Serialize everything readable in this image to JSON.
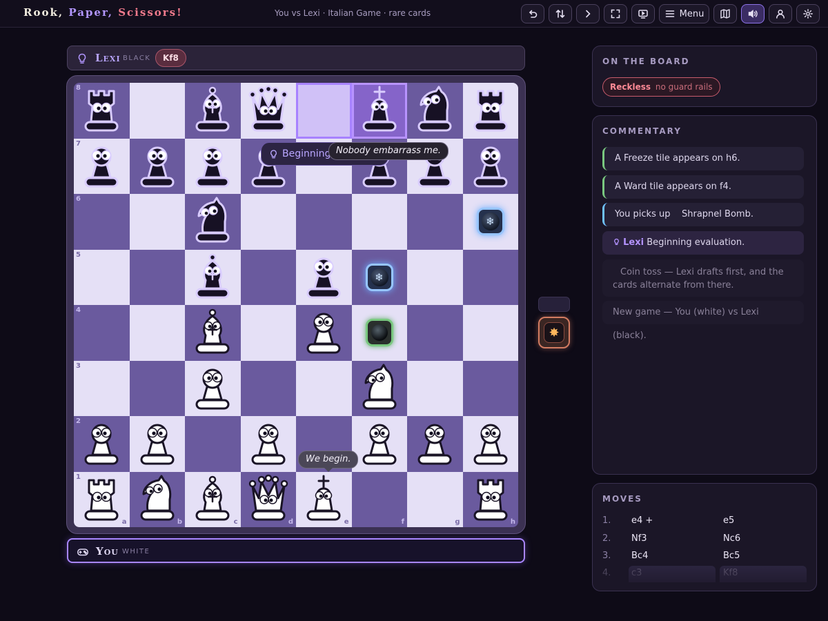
{
  "app": {
    "logo_parts": [
      "Rook, ",
      "Paper, ",
      "Scissors!"
    ],
    "subtitle": "You vs Lexi · Italian Game · rare cards"
  },
  "toolbar": {
    "menu_label": "Menu",
    "buttons": [
      "undo-icon",
      "flip-icon",
      "next-icon",
      "fullscreen-icon",
      "tv-icon",
      "menu-icon",
      "map-icon",
      "sound-icon",
      "user-icon",
      "gear-icon"
    ]
  },
  "opponent": {
    "name": "Lexi",
    "color": "black",
    "last_move": "Kf8"
  },
  "player": {
    "name": "You",
    "color": "white"
  },
  "board": {
    "files": [
      "a",
      "b",
      "c",
      "d",
      "e",
      "f",
      "g",
      "h"
    ],
    "ranks": [
      "1",
      "2",
      "3",
      "4",
      "5",
      "6",
      "7",
      "8"
    ],
    "highlight_from": "e8",
    "highlight_to": "f8",
    "pieces": [
      {
        "sq": "a8",
        "type": "rook",
        "color": "black"
      },
      {
        "sq": "c8",
        "type": "bishop",
        "color": "black"
      },
      {
        "sq": "d8",
        "type": "queen",
        "color": "black"
      },
      {
        "sq": "f8",
        "type": "king",
        "color": "black"
      },
      {
        "sq": "g8",
        "type": "knight",
        "color": "black"
      },
      {
        "sq": "h8",
        "type": "rook",
        "color": "black"
      },
      {
        "sq": "a7",
        "type": "pawn",
        "color": "black"
      },
      {
        "sq": "b7",
        "type": "pawn",
        "color": "black"
      },
      {
        "sq": "c7",
        "type": "pawn",
        "color": "black"
      },
      {
        "sq": "d7",
        "type": "pawn",
        "color": "black"
      },
      {
        "sq": "f7",
        "type": "pawn",
        "color": "black"
      },
      {
        "sq": "g7",
        "type": "pawn",
        "color": "black"
      },
      {
        "sq": "h7",
        "type": "pawn",
        "color": "black"
      },
      {
        "sq": "c6",
        "type": "knight",
        "color": "black"
      },
      {
        "sq": "c5",
        "type": "bishop",
        "color": "black"
      },
      {
        "sq": "e5",
        "type": "pawn",
        "color": "black"
      },
      {
        "sq": "c4",
        "type": "bishop",
        "color": "white"
      },
      {
        "sq": "e4",
        "type": "pawn",
        "color": "white"
      },
      {
        "sq": "c3",
        "type": "pawn",
        "color": "white"
      },
      {
        "sq": "f3",
        "type": "knight",
        "color": "white"
      },
      {
        "sq": "a2",
        "type": "pawn",
        "color": "white"
      },
      {
        "sq": "b2",
        "type": "pawn",
        "color": "white"
      },
      {
        "sq": "d2",
        "type": "pawn",
        "color": "white"
      },
      {
        "sq": "f2",
        "type": "pawn",
        "color": "white"
      },
      {
        "sq": "g2",
        "type": "pawn",
        "color": "white"
      },
      {
        "sq": "h2",
        "type": "pawn",
        "color": "white"
      },
      {
        "sq": "a1",
        "type": "rook",
        "color": "white"
      },
      {
        "sq": "b1",
        "type": "knight",
        "color": "white"
      },
      {
        "sq": "c1",
        "type": "bishop",
        "color": "white"
      },
      {
        "sq": "d1",
        "type": "queen",
        "color": "white"
      },
      {
        "sq": "e1",
        "type": "king",
        "color": "white"
      },
      {
        "sq": "h1",
        "type": "rook",
        "color": "white"
      }
    ],
    "tiles": [
      {
        "sq": "h6",
        "type": "freeze",
        "symbol": "❄"
      },
      {
        "sq": "f5",
        "type": "freeze",
        "symbol": "❄"
      },
      {
        "sq": "f4",
        "type": "ward",
        "symbol": ""
      }
    ],
    "bubbles": {
      "thinking": "Beginning",
      "lexi_quote": "Nobody embarrass me.",
      "you_quote": "We begin."
    }
  },
  "cards": {
    "held_symbol": "✸"
  },
  "on_board": {
    "title": "ON THE BOARD",
    "tag_name": "Reckless",
    "tag_desc": "no guard rails"
  },
  "commentary": {
    "title": "COMMENTARY",
    "items": [
      {
        "text": "A Freeze tile appears on h6."
      },
      {
        "text": "A Ward tile appears on f4."
      },
      {
        "text": "You picks up    Shrapnel Bomb."
      },
      {
        "who": "Lexi",
        "text": "Beginning evaluation."
      },
      {
        "text": "Coin toss — Lexi drafts first, and the cards alternate from there."
      },
      {
        "text": "New game — You (white) vs Lexi (black)."
      }
    ]
  },
  "moves": {
    "title": "MOVES",
    "rows": [
      {
        "no": "1.",
        "white": "e4 +",
        "black": "e5"
      },
      {
        "no": "2.",
        "white": "Nf3",
        "black": "Nc6"
      },
      {
        "no": "3.",
        "white": "Bc4",
        "black": "Bc5"
      },
      {
        "no": "4.",
        "white": "c3",
        "black": "Kf8"
      }
    ]
  },
  "colors": {
    "accent": "#a986ff",
    "light_square": "#e5e0f6",
    "dark_square": "#6a5a9e",
    "danger": "#c85b6c"
  }
}
